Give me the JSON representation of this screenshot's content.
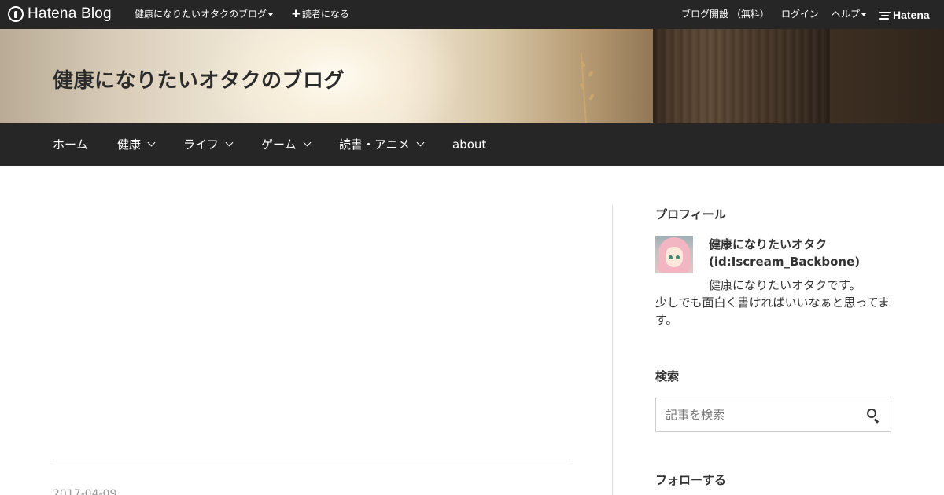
{
  "globalbar": {
    "logo_text": "Hatena Blog",
    "blog_menu_label": "健康になりたいオタクのブログ",
    "subscribe_label": "読者になる",
    "open_blog_label": "ブログ開設 （無料）",
    "login_label": "ログイン",
    "help_label": "ヘルプ",
    "brand_label": "Hatena"
  },
  "header": {
    "title": "健康になりたいオタクのブログ"
  },
  "nav": {
    "items": [
      {
        "label": "ホーム",
        "has_dropdown": false
      },
      {
        "label": "健康",
        "has_dropdown": true
      },
      {
        "label": "ライフ",
        "has_dropdown": true
      },
      {
        "label": "ゲーム",
        "has_dropdown": true
      },
      {
        "label": "読書・アニメ",
        "has_dropdown": true
      },
      {
        "label": "about",
        "has_dropdown": false
      }
    ]
  },
  "main": {
    "entry_date": "2017-04-09"
  },
  "sidebar": {
    "profile": {
      "heading": "プロフィール",
      "name": "健康になりたいオタク",
      "id": "(id:Iscream_Backbone)",
      "description_line1": "健康になりたいオタクです。",
      "description_line2": "少しでも面白く書ければいいなぁと思ってます。"
    },
    "search": {
      "heading": "検索",
      "placeholder": "記事を検索"
    },
    "follow": {
      "heading": "フォローする"
    }
  },
  "colors": {
    "bar_background": "#262626",
    "text": "#333333",
    "divider": "#dddddd"
  }
}
